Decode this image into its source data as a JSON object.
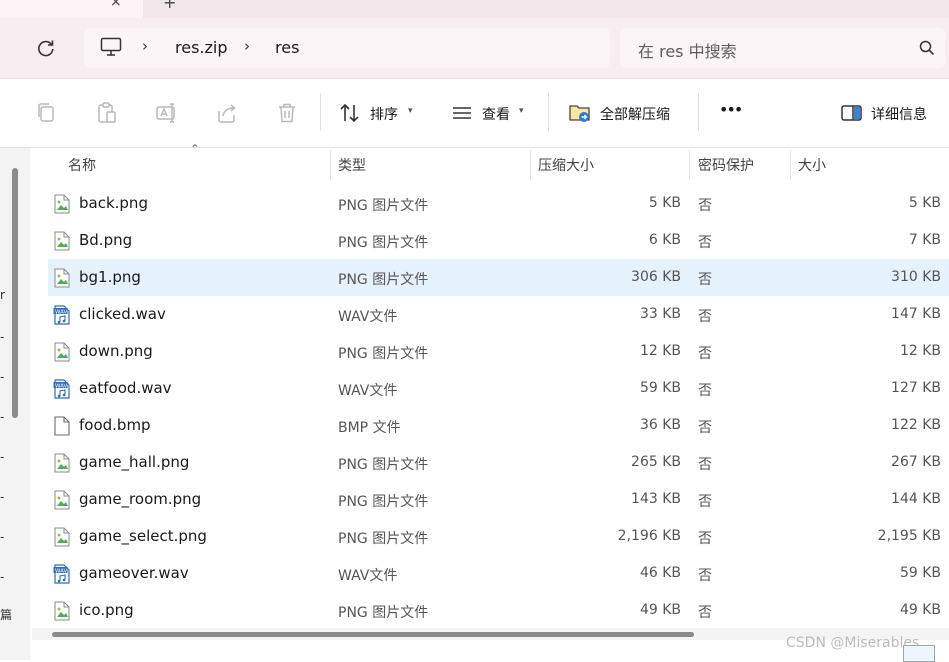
{
  "titlebar": {
    "close_glyph": "×",
    "add_glyph": "+"
  },
  "address": {
    "refresh_icon": "refresh-icon",
    "root_icon": "computer-icon",
    "breadcrumbs": [
      "res.zip",
      "res"
    ],
    "separator": "›"
  },
  "search": {
    "placeholder": "在 res 中搜索",
    "icon": "search-icon"
  },
  "toolbar": {
    "copy_icon": "copy-icon",
    "paste_icon": "paste-icon",
    "rename_icon": "rename-icon",
    "share_icon": "share-icon",
    "delete_icon": "delete-icon",
    "sort_label": "排序",
    "view_label": "查看",
    "extract_label": "全部解压缩",
    "more_label": "•••",
    "details_label": "详细信息"
  },
  "nav": {
    "marks": [
      "r",
      "-",
      "-",
      "-",
      "-",
      "-",
      "-",
      "-",
      "篇"
    ]
  },
  "columns": {
    "name": "名称",
    "type": "类型",
    "compressed": "压缩大小",
    "password": "密码保护",
    "size": "大小"
  },
  "files": [
    {
      "name": "back.png",
      "type": "PNG 图片文件",
      "compressed": "5 KB",
      "password": "否",
      "size": "5 KB",
      "icon": "png"
    },
    {
      "name": "Bd.png",
      "type": "PNG 图片文件",
      "compressed": "6 KB",
      "password": "否",
      "size": "7 KB",
      "icon": "png"
    },
    {
      "name": "bg1.png",
      "type": "PNG 图片文件",
      "compressed": "306 KB",
      "password": "否",
      "size": "310 KB",
      "icon": "png",
      "selected": true
    },
    {
      "name": "clicked.wav",
      "type": "WAV文件",
      "compressed": "33 KB",
      "password": "否",
      "size": "147 KB",
      "icon": "wav"
    },
    {
      "name": "down.png",
      "type": "PNG 图片文件",
      "compressed": "12 KB",
      "password": "否",
      "size": "12 KB",
      "icon": "png"
    },
    {
      "name": "eatfood.wav",
      "type": "WAV文件",
      "compressed": "59 KB",
      "password": "否",
      "size": "127 KB",
      "icon": "wav"
    },
    {
      "name": "food.bmp",
      "type": "BMP 文件",
      "compressed": "36 KB",
      "password": "否",
      "size": "122 KB",
      "icon": "bmp"
    },
    {
      "name": "game_hall.png",
      "type": "PNG 图片文件",
      "compressed": "265 KB",
      "password": "否",
      "size": "267 KB",
      "icon": "png"
    },
    {
      "name": "game_room.png",
      "type": "PNG 图片文件",
      "compressed": "143 KB",
      "password": "否",
      "size": "144 KB",
      "icon": "png"
    },
    {
      "name": "game_select.png",
      "type": "PNG 图片文件",
      "compressed": "2,196 KB",
      "password": "否",
      "size": "2,195 KB",
      "icon": "png"
    },
    {
      "name": "gameover.wav",
      "type": "WAV文件",
      "compressed": "46 KB",
      "password": "否",
      "size": "59 KB",
      "icon": "wav"
    },
    {
      "name": "ico.png",
      "type": "PNG 图片文件",
      "compressed": "49 KB",
      "password": "否",
      "size": "49 KB",
      "icon": "png"
    }
  ],
  "watermark": "CSDN @Miserables"
}
